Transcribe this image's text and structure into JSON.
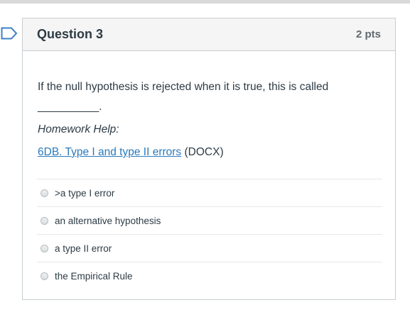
{
  "question": {
    "title": "Question 3",
    "points": "2 pts",
    "text": "If the null hypothesis is rejected when it is true, this is called",
    "blank": "__________.",
    "help_label": "Homework Help:",
    "link_text": "6DB. Type I and type II errors",
    "link_suffix": " (DOCX)"
  },
  "answers": [
    ">a type I error",
    "an alternative hypothesis",
    "a type II error",
    "the Empirical Rule"
  ],
  "icons": {
    "bookmark": "bookmark-icon"
  },
  "colors": {
    "link": "#2b7abc",
    "bookmark": "#3b80c6",
    "border": "#c7cdd1"
  }
}
